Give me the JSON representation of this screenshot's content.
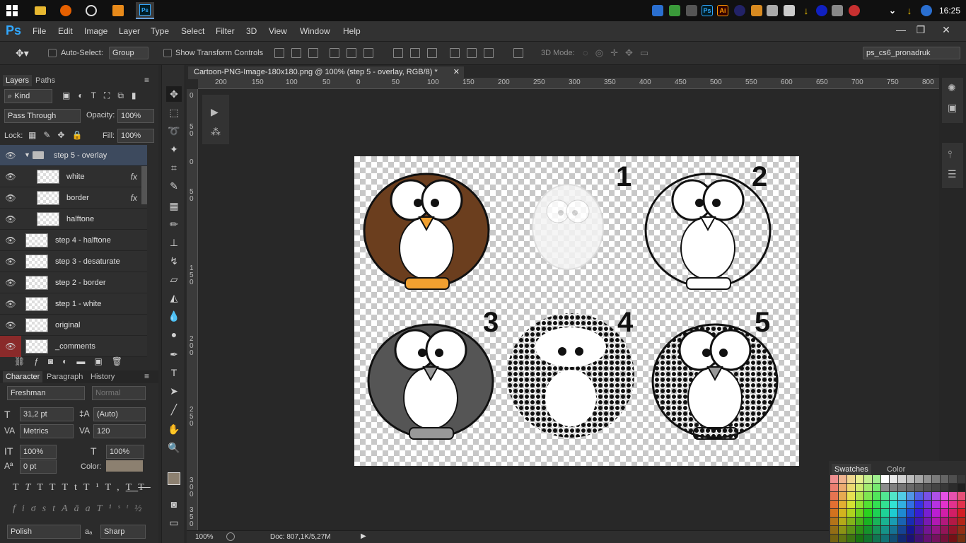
{
  "taskbar": {
    "apps": [
      "start",
      "explorer",
      "firefox",
      "chrome-like",
      "tool",
      "photoshop"
    ],
    "clock": "16:25"
  },
  "app": {
    "logo": "Ps",
    "menu": [
      "File",
      "Edit",
      "Image",
      "Layer",
      "Type",
      "Select",
      "Filter",
      "3D",
      "View",
      "Window",
      "Help"
    ],
    "window_controls": [
      "—",
      "❐",
      "✕"
    ]
  },
  "options": {
    "auto_select_label": "Auto-Select:",
    "auto_select_value": "Group",
    "show_transform_label": "Show Transform Controls",
    "mode_3d_label": "3D Mode:",
    "workspace": "ps_cs6_pronadruk"
  },
  "layers_panel": {
    "tabs": [
      "Layers",
      "Paths"
    ],
    "filter_kind": "Kind",
    "blend_mode": "Pass Through",
    "opacity_label": "Opacity:",
    "opacity_value": "100%",
    "lock_label": "Lock:",
    "fill_label": "Fill:",
    "fill_value": "100%",
    "layers": [
      {
        "name": "step 5 - overlay",
        "type": "group",
        "selected": true
      },
      {
        "name": "white",
        "fx": true,
        "indent": true
      },
      {
        "name": "border",
        "fx": true,
        "indent": true
      },
      {
        "name": "halftone",
        "indent": true
      },
      {
        "name": "step 4 - halftone"
      },
      {
        "name": "step 3 - desaturate"
      },
      {
        "name": "step 2 - border"
      },
      {
        "name": "step 1 - white"
      },
      {
        "name": "original"
      },
      {
        "name": "_comments",
        "red_eye": true
      }
    ]
  },
  "character_panel": {
    "tabs": [
      "Character",
      "Paragraph",
      "History"
    ],
    "font_family": "Freshman",
    "font_style": "Normal",
    "size": "31,2 pt",
    "leading": "(Auto)",
    "kerning": "Metrics",
    "tracking": "120",
    "vscale": "100%",
    "hscale": "100%",
    "baseline": "0 pt",
    "color_label": "Color:",
    "language": "Polish",
    "aa_label": "aₐ",
    "antialias": "Sharp"
  },
  "document": {
    "tab_title": "Cartoon-PNG-Image-180x180.png @ 100% (step 5 - overlay, RGB/8) *",
    "ruler_h": [
      "200",
      "150",
      "100",
      "50",
      "0",
      "50",
      "100",
      "150",
      "200",
      "250",
      "300",
      "350",
      "400",
      "450",
      "500",
      "550",
      "600",
      "650",
      "700",
      "750",
      "800"
    ],
    "ruler_v": [
      "0",
      "5",
      "0",
      "0",
      "5",
      "0",
      "1",
      "5",
      "0",
      "2",
      "0",
      "0",
      "2",
      "5",
      "0",
      "3",
      "0",
      "0",
      "3",
      "5",
      "0",
      "4",
      "0",
      "0",
      "4",
      "5",
      "0"
    ],
    "labels": [
      "1",
      "2",
      "3",
      "4",
      "5"
    ]
  },
  "status": {
    "zoom": "100%",
    "doc": "Doc: 807,1K/5,27M"
  },
  "swatches_panel": {
    "tabs": [
      "Swatches",
      "Color"
    ]
  },
  "colors": {
    "accent": "#3d4a5e",
    "ps_blue": "#31a8ff",
    "owl_brown": "#6b3e1e",
    "foreground": "#8c8070"
  }
}
